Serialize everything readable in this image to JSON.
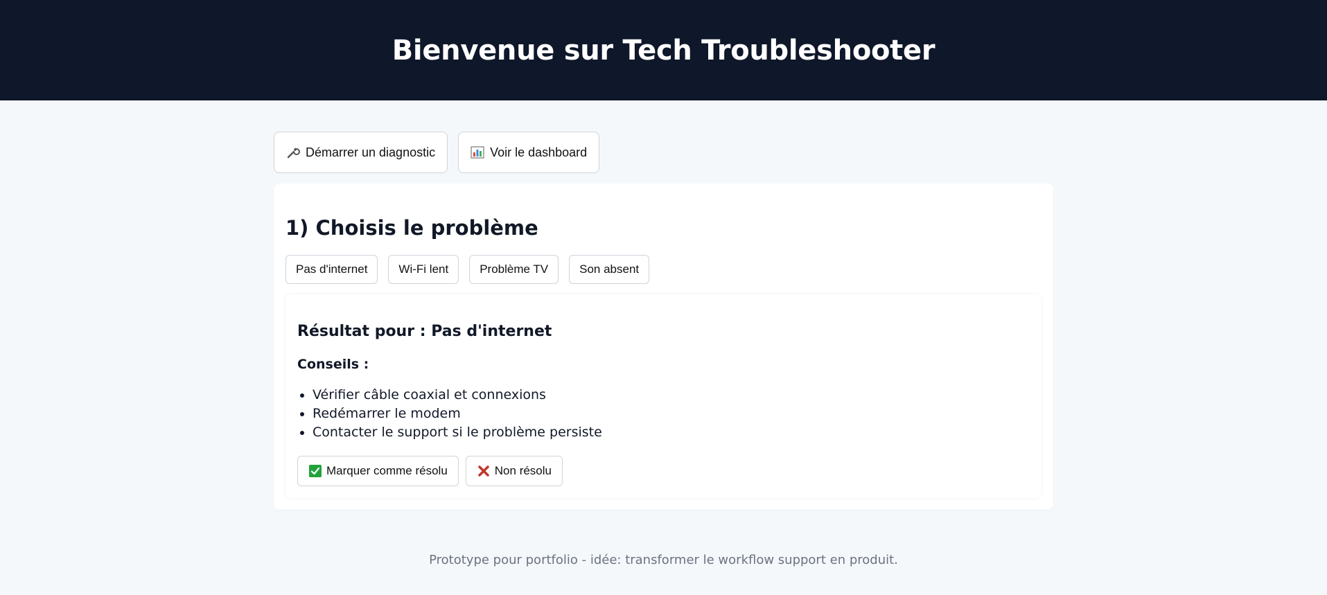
{
  "header": {
    "title": "Bienvenue sur Tech Troubleshooter"
  },
  "nav": {
    "start_diagnostic": {
      "label": "Démarrer un diagnostic",
      "icon": "wrench-icon"
    },
    "dashboard": {
      "label": "Voir le dashboard",
      "icon": "bar-chart-icon"
    }
  },
  "step": {
    "title": "1) Choisis le problème",
    "problems": [
      "Pas d'internet",
      "Wi-Fi lent",
      "Problème TV",
      "Son absent"
    ]
  },
  "result": {
    "title": "Résultat pour : Pas d'internet",
    "tips_heading": "Conseils :",
    "tips": [
      "Vérifier câble coaxial et connexions",
      "Redémarrer le modem",
      "Contacter le support si le problème persiste"
    ],
    "resolved_label": "Marquer comme résolu",
    "unresolved_label": "Non résolu"
  },
  "footer": {
    "text": "Prototype pour portfolio - idée: transformer le workflow support en produit."
  },
  "colors": {
    "header_bg": "#0f172a",
    "page_bg": "#f4f8fb",
    "check_green": "#22a33a",
    "cross_red": "#c0392b"
  }
}
